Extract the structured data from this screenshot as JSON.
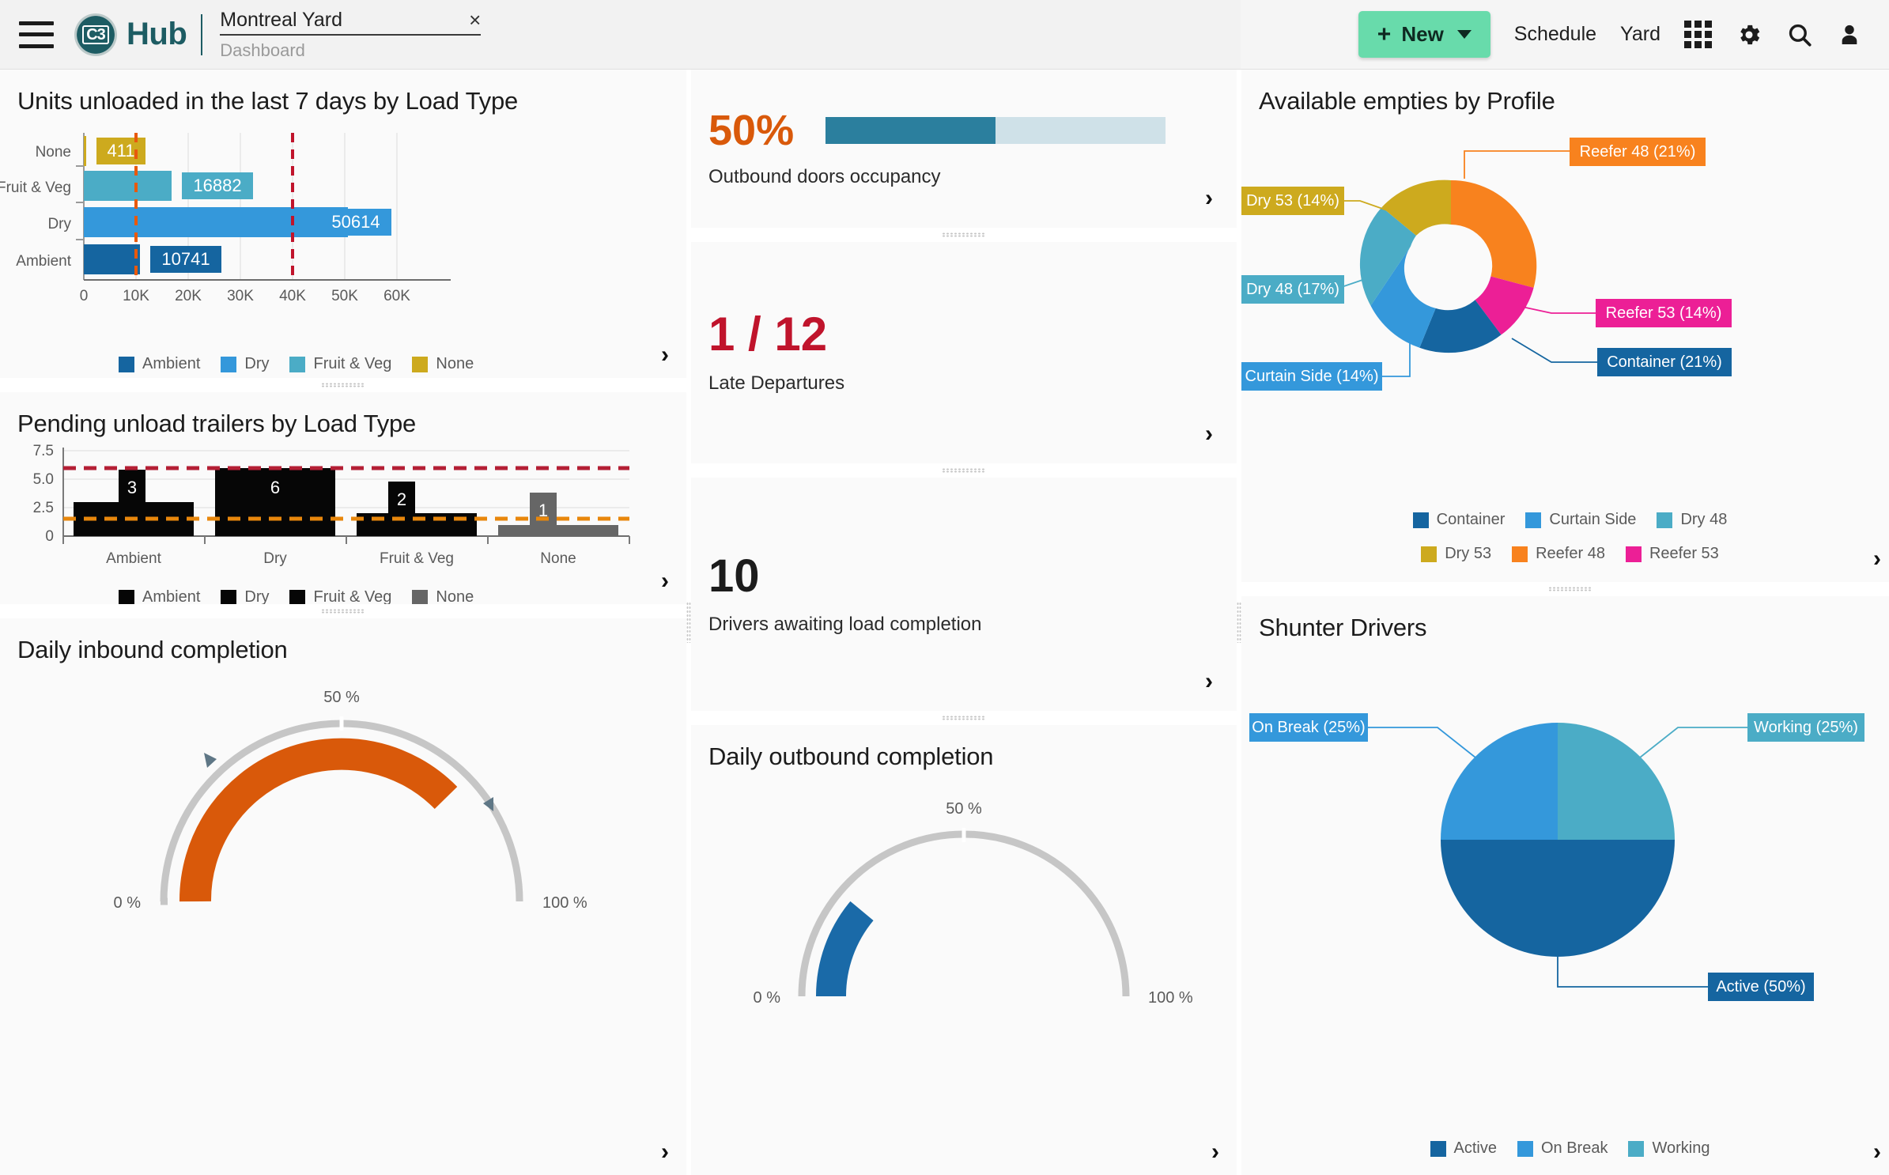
{
  "header": {
    "brand_mark": "C3",
    "brand_name": "Hub",
    "tab_title": "Montreal Yard",
    "tab_subtitle": "Dashboard",
    "close_label": "×",
    "new_button": "New",
    "new_plus": "+",
    "nav": [
      {
        "label": "Schedule"
      },
      {
        "label": "Yard"
      }
    ],
    "icons": [
      "apps-grid-icon",
      "gear-icon",
      "search-icon",
      "user-icon"
    ],
    "accent_new": "#68dbab"
  },
  "cards": {
    "units_unloaded": {
      "title": "Units unloaded in the last 7 days by Load Type",
      "chevron": "›"
    },
    "pending_unload": {
      "title": "Pending unload trailers by Load Type",
      "chevron": "›"
    },
    "daily_inbound": {
      "title": "Daily inbound completion",
      "chevron": "›"
    },
    "outbound_doors": {
      "value": "50%",
      "label": "Outbound doors occupancy",
      "percent": 50,
      "value_color": "#d9590a",
      "bar_fill": "#2b7f9e",
      "bar_track": "#cfe1e8",
      "chevron": "›"
    },
    "late_departures": {
      "value": "1 / 12",
      "label": "Late Departures",
      "value_color": "#c0142c",
      "chevron": "›"
    },
    "drivers_awaiting": {
      "value": "10",
      "label": "Drivers awaiting load completion",
      "value_color": "#1c1c1c",
      "chevron": "›"
    },
    "daily_outbound": {
      "title": "Daily outbound completion",
      "chevron": "›"
    },
    "available_empties": {
      "title": "Available empties by Profile",
      "chevron": "›"
    },
    "shunter_drivers": {
      "title": "Shunter Drivers",
      "chevron": "›"
    }
  },
  "chart_data": [
    {
      "id": "units_unloaded",
      "type": "bar",
      "orientation": "horizontal",
      "title": "Units unloaded in the last 7 days by Load Type",
      "categories": [
        "None",
        "Fruit & Veg",
        "Dry",
        "Ambient"
      ],
      "values": [
        411,
        16882,
        50614,
        10741
      ],
      "data_labels": [
        "411",
        "16882",
        "50614",
        "10741"
      ],
      "colors": [
        "#cdaa1e",
        "#4bacc6",
        "#3498db",
        "#1565a0"
      ],
      "xlabel": "",
      "ylabel": "",
      "xlim": [
        0,
        60000
      ],
      "xticks": [
        0,
        10000,
        20000,
        30000,
        40000,
        50000,
        60000
      ],
      "xtick_labels": [
        "0",
        "10K",
        "20K",
        "30K",
        "40K",
        "50K",
        "60K"
      ],
      "grid": true,
      "reference_lines": [
        {
          "value": 10000,
          "color": "#e8590c",
          "style": "dashed"
        },
        {
          "value": 40000,
          "color": "#c0142c",
          "style": "dashed"
        }
      ],
      "legend": [
        {
          "label": "Ambient",
          "color": "#1565a0"
        },
        {
          "label": "Dry",
          "color": "#3498db"
        },
        {
          "label": "Fruit & Veg",
          "color": "#4bacc6"
        },
        {
          "label": "None",
          "color": "#cdaa1e"
        }
      ],
      "legend_position": "bottom"
    },
    {
      "id": "pending_unload",
      "type": "bar",
      "orientation": "vertical",
      "title": "Pending unload trailers by Load Type",
      "categories": [
        "Ambient",
        "Dry",
        "Fruit & Veg",
        "None"
      ],
      "values": [
        3,
        6,
        2,
        1
      ],
      "data_labels": [
        "3",
        "6",
        "2",
        "1"
      ],
      "colors": [
        "#060606",
        "#060606",
        "#060606",
        "#666666"
      ],
      "ylim": [
        0,
        7.5
      ],
      "yticks": [
        0,
        2.5,
        5.0,
        7.5
      ],
      "ytick_labels": [
        "0",
        "2.5",
        "5.0",
        "7.5"
      ],
      "grid": true,
      "reference_lines": [
        {
          "value": 6,
          "color": "#b41f35",
          "style": "dashed"
        },
        {
          "value": 1.5,
          "color": "#e8870c",
          "style": "dashed"
        }
      ],
      "legend": [
        {
          "label": "Ambient",
          "color": "#060606"
        },
        {
          "label": "Dry",
          "color": "#060606"
        },
        {
          "label": "Fruit & Veg",
          "color": "#060606"
        },
        {
          "label": "None",
          "color": "#666666"
        }
      ],
      "legend_position": "bottom"
    },
    {
      "id": "daily_inbound",
      "type": "gauge",
      "title": "Daily inbound completion",
      "value": 65,
      "min": 0,
      "max": 100,
      "tick_labels": [
        "0 %",
        "50 %",
        "100 %"
      ],
      "arc_color": "#d9590a",
      "track_color": "#c6c6c6",
      "threshold_markers": [
        35,
        78
      ],
      "marker_color": "#5f7786"
    },
    {
      "id": "daily_outbound",
      "type": "gauge",
      "title": "Daily outbound completion",
      "value": 22,
      "min": 0,
      "max": 100,
      "tick_labels": [
        "0 %",
        "50 %",
        "100 %"
      ],
      "arc_color": "#1a6aa8",
      "track_color": "#c6c6c6",
      "threshold_markers": [],
      "marker_color": "#5f7786"
    },
    {
      "id": "available_empties",
      "type": "pie",
      "variant": "donut",
      "title": "Available empties by Profile",
      "labels": [
        "Reefer 48",
        "Reefer 53",
        "Container",
        "Curtain Side",
        "Dry 48",
        "Dry 53"
      ],
      "values": [
        21,
        14,
        21,
        14,
        17,
        14
      ],
      "callouts": [
        "Reefer 48 (21%)",
        "Reefer 53 (14%)",
        "Container (21%)",
        "Curtain Side (14%)",
        "Dry 48 (17%)",
        "Dry 53 (14%)"
      ],
      "colors": [
        "#f8821e",
        "#ec1f96",
        "#1565a0",
        "#3498db",
        "#4bacc6",
        "#cdaa1e"
      ],
      "legend": [
        {
          "label": "Container",
          "color": "#1565a0"
        },
        {
          "label": "Curtain Side",
          "color": "#3498db"
        },
        {
          "label": "Dry 48",
          "color": "#4bacc6"
        },
        {
          "label": "Dry 53",
          "color": "#cdaa1e"
        },
        {
          "label": "Reefer 48",
          "color": "#f8821e"
        },
        {
          "label": "Reefer 53",
          "color": "#ec1f96"
        }
      ],
      "legend_position": "bottom"
    },
    {
      "id": "shunter_drivers",
      "type": "pie",
      "variant": "pie",
      "title": "Shunter Drivers",
      "labels": [
        "Working",
        "Active",
        "On Break"
      ],
      "values": [
        25,
        50,
        25
      ],
      "callouts": [
        "Working (25%)",
        "Active (50%)",
        "On Break (25%)"
      ],
      "colors": [
        "#4bacc6",
        "#1565a0",
        "#3498db"
      ],
      "legend": [
        {
          "label": "Active",
          "color": "#1565a0"
        },
        {
          "label": "On Break",
          "color": "#3498db"
        },
        {
          "label": "Working",
          "color": "#4bacc6"
        }
      ],
      "legend_position": "bottom"
    }
  ]
}
